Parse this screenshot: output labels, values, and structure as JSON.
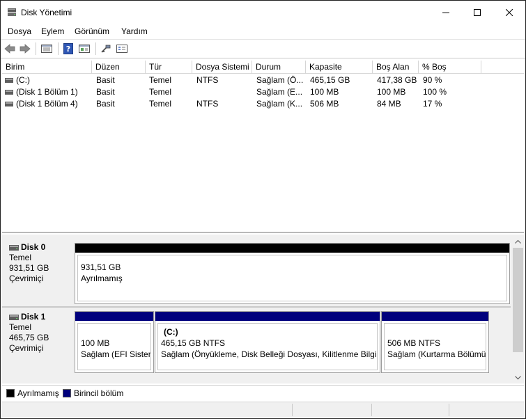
{
  "window": {
    "title": "Disk Yönetimi"
  },
  "menu": [
    "Dosya",
    "Eylem",
    "Görünüm",
    "Yardım"
  ],
  "toolbar": [
    "back-icon",
    "forward-icon",
    "console-tree-icon",
    "help-icon",
    "properties-icon",
    "connect-icon",
    "settings-icon"
  ],
  "list": {
    "columns": [
      "Birim",
      "Düzen",
      "Tür",
      "Dosya Sistemi",
      "Durum",
      "Kapasite",
      "Boş Alan",
      "% Boş"
    ],
    "rows": [
      {
        "birim": " (C:)",
        "duzen": "Basit",
        "tur": "Temel",
        "dosya": "NTFS",
        "durum": "Sağlam (Ö...",
        "kapasite": "465,15 GB",
        "bos": "417,38 GB",
        "yuzde": "90 %"
      },
      {
        "birim": "(Disk 1 Bölüm 1)",
        "duzen": "Basit",
        "tur": "Temel",
        "dosya": "",
        "durum": "Sağlam (E...",
        "kapasite": "100 MB",
        "bos": "100 MB",
        "yuzde": "100 %"
      },
      {
        "birim": "(Disk 1 Bölüm 4)",
        "duzen": "Basit",
        "tur": "Temel",
        "dosya": "NTFS",
        "durum": "Sağlam (K...",
        "kapasite": "506 MB",
        "bos": "84 MB",
        "yuzde": "17 %"
      }
    ]
  },
  "disks": [
    {
      "name": "Disk 0",
      "type": "Temel",
      "size": "931,51 GB",
      "status": "Çevrimiçi",
      "partitions": [
        {
          "label": "",
          "size": "931,51 GB",
          "status": "Ayrılmamış",
          "kind": "unallocated"
        }
      ]
    },
    {
      "name": "Disk 1",
      "type": "Temel",
      "size": "465,75 GB",
      "status": "Çevrimiçi",
      "partitions": [
        {
          "label": "",
          "size": "100 MB",
          "status": "Sağlam (EFI Sistem",
          "kind": "primary"
        },
        {
          "label": "(C:)",
          "size": "465,15 GB NTFS",
          "status": "Sağlam (Önyükleme, Disk Belleği Dosyası, Kilitlenme Bilgisi",
          "kind": "primary"
        },
        {
          "label": "",
          "size": "506 MB NTFS",
          "status": "Sağlam (Kurtarma Bölümü",
          "kind": "primary"
        }
      ]
    }
  ],
  "legend": [
    {
      "label": "Ayrılmamış",
      "color": "#000000"
    },
    {
      "label": "Birincil bölüm",
      "color": "#00007d"
    }
  ],
  "colors": {
    "unallocated": "#000000",
    "primary": "#00007d"
  }
}
